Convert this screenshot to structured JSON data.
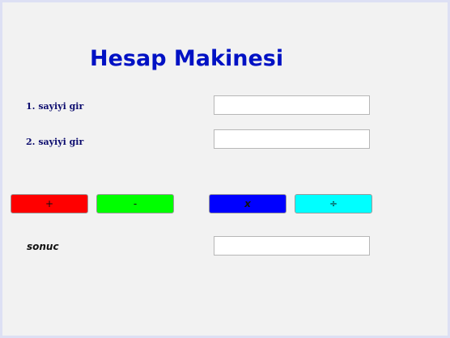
{
  "app": {
    "title": "Hesap Makinesi"
  },
  "inputs": {
    "first_label": "1. sayiyi gir",
    "first_value": "",
    "second_label": "2. sayiyi gir",
    "second_value": ""
  },
  "operations": {
    "add_label": "+",
    "subtract_label": "-",
    "multiply_label": "x",
    "divide_label": "÷"
  },
  "result": {
    "label": "sonuc",
    "value": ""
  },
  "colors": {
    "title": "#0011c4",
    "add": "#ff0000",
    "subtract": "#00ff00",
    "multiply": "#0000ff",
    "divide": "#00ffff",
    "background": "#f2f2f2"
  }
}
